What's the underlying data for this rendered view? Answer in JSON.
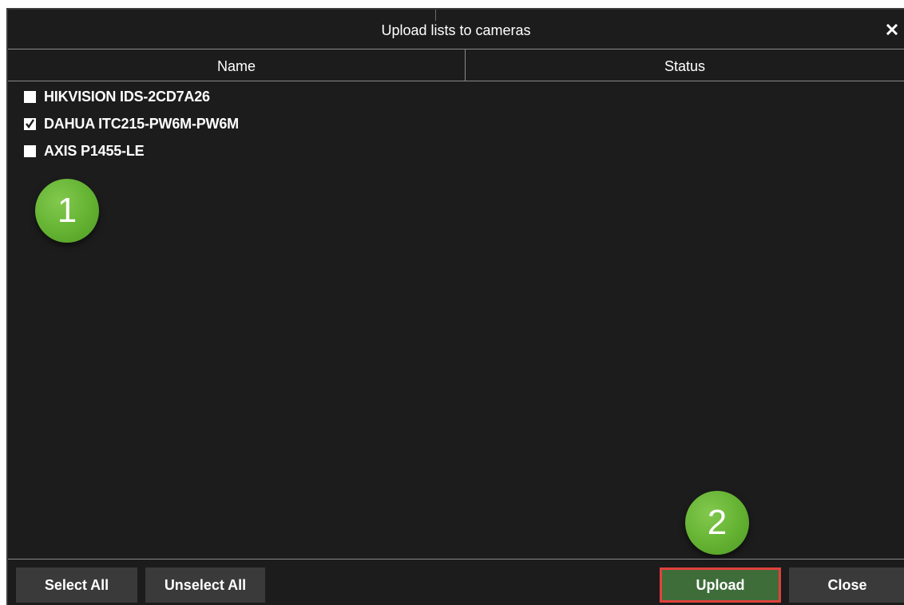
{
  "dialog": {
    "title": "Upload lists to cameras",
    "close_glyph": "✕",
    "close_icon": "close-icon"
  },
  "columns": {
    "name": "Name",
    "status": "Status"
  },
  "cameras": [
    {
      "label": "HIKVISION IDS-2CD7A26",
      "checked": false
    },
    {
      "label": "DAHUA ITC215-PW6M-PW6M",
      "checked": true
    },
    {
      "label": "AXIS P1455-LE",
      "checked": false
    }
  ],
  "annotations": {
    "step1": "1",
    "step2": "2",
    "badge_color": "#64b232",
    "highlight_color": "#e0413c"
  },
  "buttons": {
    "select_all": "Select All",
    "unselect_all": "Unselect All",
    "upload": "Upload",
    "close": "Close"
  },
  "colors": {
    "background": "#1c1c1c",
    "button": "#3a3a3a",
    "upload_button": "#3e6d3a",
    "divider": "#8a8a8a"
  }
}
